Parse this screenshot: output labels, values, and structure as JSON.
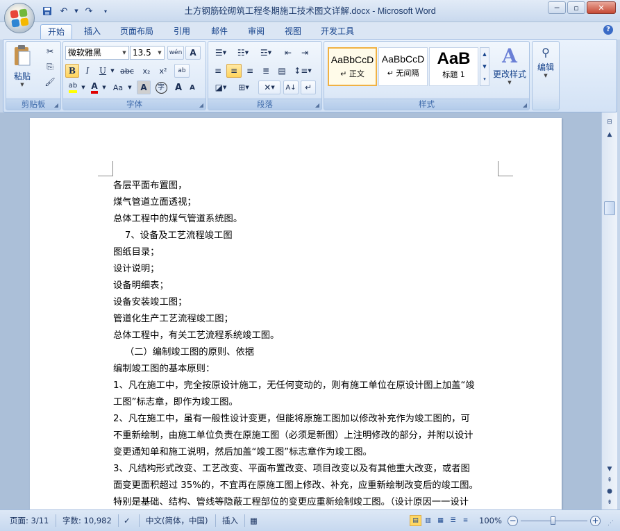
{
  "window": {
    "title": "土方钢筋砼砌筑工程冬期施工技术图文详解.docx - Microsoft Word",
    "minimize": "─",
    "restore": "▫",
    "close": "✕"
  },
  "qat": {
    "save_icon": "save-icon",
    "undo_icon": "undo-icon",
    "redo_icon": "redo-icon",
    "customize_icon": "dropdown-icon"
  },
  "tabs": [
    {
      "label": "开始",
      "active": true
    },
    {
      "label": "插入"
    },
    {
      "label": "页面布局"
    },
    {
      "label": "引用"
    },
    {
      "label": "邮件"
    },
    {
      "label": "审阅"
    },
    {
      "label": "视图"
    },
    {
      "label": "开发工具"
    }
  ],
  "help": "?",
  "clipboard": {
    "group_label": "剪贴板",
    "paste_label": "粘贴"
  },
  "font": {
    "group_label": "字体",
    "font_name": "微软雅黑",
    "font_size": "13.5",
    "grow_label": "A",
    "bold": "B",
    "italic": "I",
    "underline": "U",
    "strike": "abc",
    "subscript": "x₂",
    "superscript": "x²",
    "clear_format": "ab",
    "case_label": "Aa",
    "phonetic_label": "wén",
    "char_border": "A",
    "shading": "A",
    "enclose": "字",
    "grow_font": "A",
    "shrink_font": "A"
  },
  "paragraph": {
    "group_label": "段落"
  },
  "styles": {
    "group_label": "样式",
    "cards": [
      {
        "sample": "AaBbCcD",
        "name": "↵ 正文",
        "selected": true
      },
      {
        "sample": "AaBbCcD",
        "name": "↵ 无间隔"
      },
      {
        "sample": "AaB",
        "name": "标题 1"
      }
    ],
    "change_styles": "更改样式"
  },
  "editing": {
    "label": "编辑"
  },
  "document": {
    "lines": [
      "各层平面布置图，",
      "煤气管道立面透视；",
      "总体工程中的煤气管道系统图。",
      "    7、设备及工艺流程竣工图",
      "图纸目录；",
      "设计说明；",
      "设备明细表；",
      "设备安装竣工图；",
      "管道化生产工艺流程竣工图；",
      "总体工程中，有关工艺流程系统竣工图。",
      "    （二）编制竣工图的原则、依据",
      "编制竣工图的基本原则：",
      "1、凡在施工中，完全按原设计施工，无任何变动的，则有施工单位在原设计图上加盖“竣",
      "工图”标志章，即作为竣工图。",
      "2、凡在施工中，虽有一般性设计变更，但能将原施工图加以修改补充作为竣工图的，可",
      "不重新绘制，由施工单位负责在原施工图（必须是新图）上注明修改的部分，并附以设计",
      "变更通知单和施工说明，然后加盖“竣工图”标志章作为竣工图。",
      "3、凡结构形式改变、工艺改变、平面布置改变、项目改变以及有其他重大改变，或者图",
      "面变更面积超过 35%的，不宜再在原施工图上修改、补充，应重新绘制改变后的竣工图。",
      "特别是基础、结构、管线等隐蔽工程部位的变更应重新绘制竣工图。（设计原因一一设计"
    ]
  },
  "status": {
    "page": "页面: 3/11",
    "words": "字数: 10,982",
    "language": "中文(简体，中国)",
    "mode": "插入",
    "zoom": "100%",
    "zoom_minus": "−",
    "zoom_plus": "+"
  },
  "colors": {
    "highlight": "#ffff00",
    "font_color": "#e00000",
    "accent": "#15428b"
  }
}
